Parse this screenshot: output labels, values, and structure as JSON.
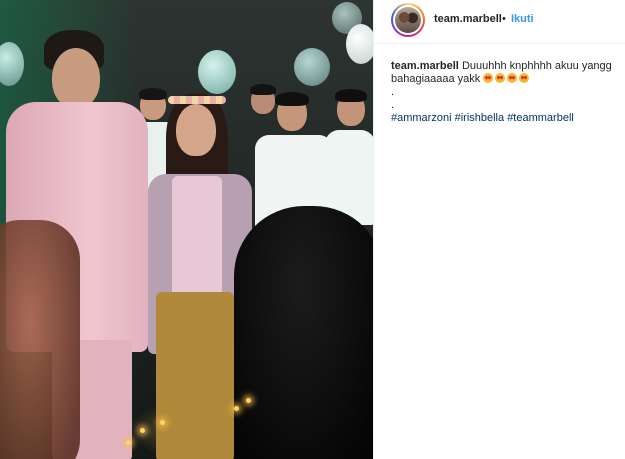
{
  "post": {
    "username": "team.marbell",
    "separator": "•",
    "follow_label": "Ikuti"
  },
  "caption": {
    "username": "team.marbell",
    "line1": "Duuuhhh knphhhh akuu yangg bahagiaaaaa yakk",
    "emojis": [
      "heart-eyes-emoji",
      "heart-eyes-emoji",
      "heart-eyes-emoji",
      "heart-eyes-emoji"
    ],
    "dot1": ".",
    "dot2": ".",
    "hashtags": [
      "#ammarzoni",
      "#irishbella",
      "#teammarbell"
    ]
  },
  "colors": {
    "link": "#3897f0",
    "hashtag": "#003569",
    "text": "#262626"
  }
}
